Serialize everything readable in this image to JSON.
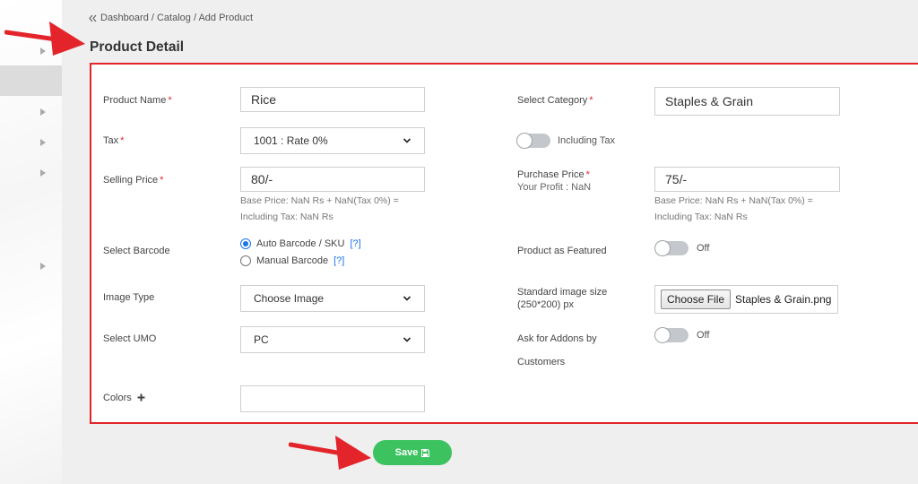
{
  "breadcrumb": {
    "text": "Dashboard / Catalog / Add Product"
  },
  "page_title": "Product Detail",
  "form": {
    "product_name": {
      "label": "Product Name",
      "value": "Rice"
    },
    "select_category": {
      "label": "Select Category",
      "value": "Staples & Grain"
    },
    "tax": {
      "label": "Tax",
      "value": "1001 : Rate 0%"
    },
    "including_tax": {
      "label": "Including Tax"
    },
    "selling_price": {
      "label": "Selling Price",
      "value": "80/-",
      "hint_line1": "Base Price: NaN Rs + NaN(Tax 0%) =",
      "hint_line2": "Including Tax: NaN Rs"
    },
    "purchase_price": {
      "label": "Purchase Price",
      "sublabel": "Your Profit : NaN",
      "value": "75/-",
      "hint_line1": "Base Price: NaN Rs + NaN(Tax 0%) =",
      "hint_line2": "Including Tax: NaN Rs"
    },
    "select_barcode": {
      "label": "Select Barcode",
      "option_auto": "Auto Barcode / SKU",
      "option_manual": "Manual Barcode",
      "help": "[?]"
    },
    "product_featured": {
      "label": "Product as Featured",
      "state": "Off"
    },
    "image_type": {
      "label": "Image Type",
      "value": "Choose Image"
    },
    "image_size": {
      "label_line1": "Standard image size",
      "label_line2": "(250*200) px",
      "button": "Choose File",
      "file": "Staples & Grain.png"
    },
    "select_umo": {
      "label": "Select UMO",
      "value": "PC"
    },
    "addons": {
      "label_line1": "Ask for Addons by",
      "label_line2": "Customers",
      "state": "Off"
    },
    "colors": {
      "label": "Colors",
      "value": ""
    }
  },
  "save_label": "Save",
  "colors": {
    "accent_red": "#e3242b",
    "save_green": "#3cc35f",
    "link_blue": "#1a73e8"
  }
}
